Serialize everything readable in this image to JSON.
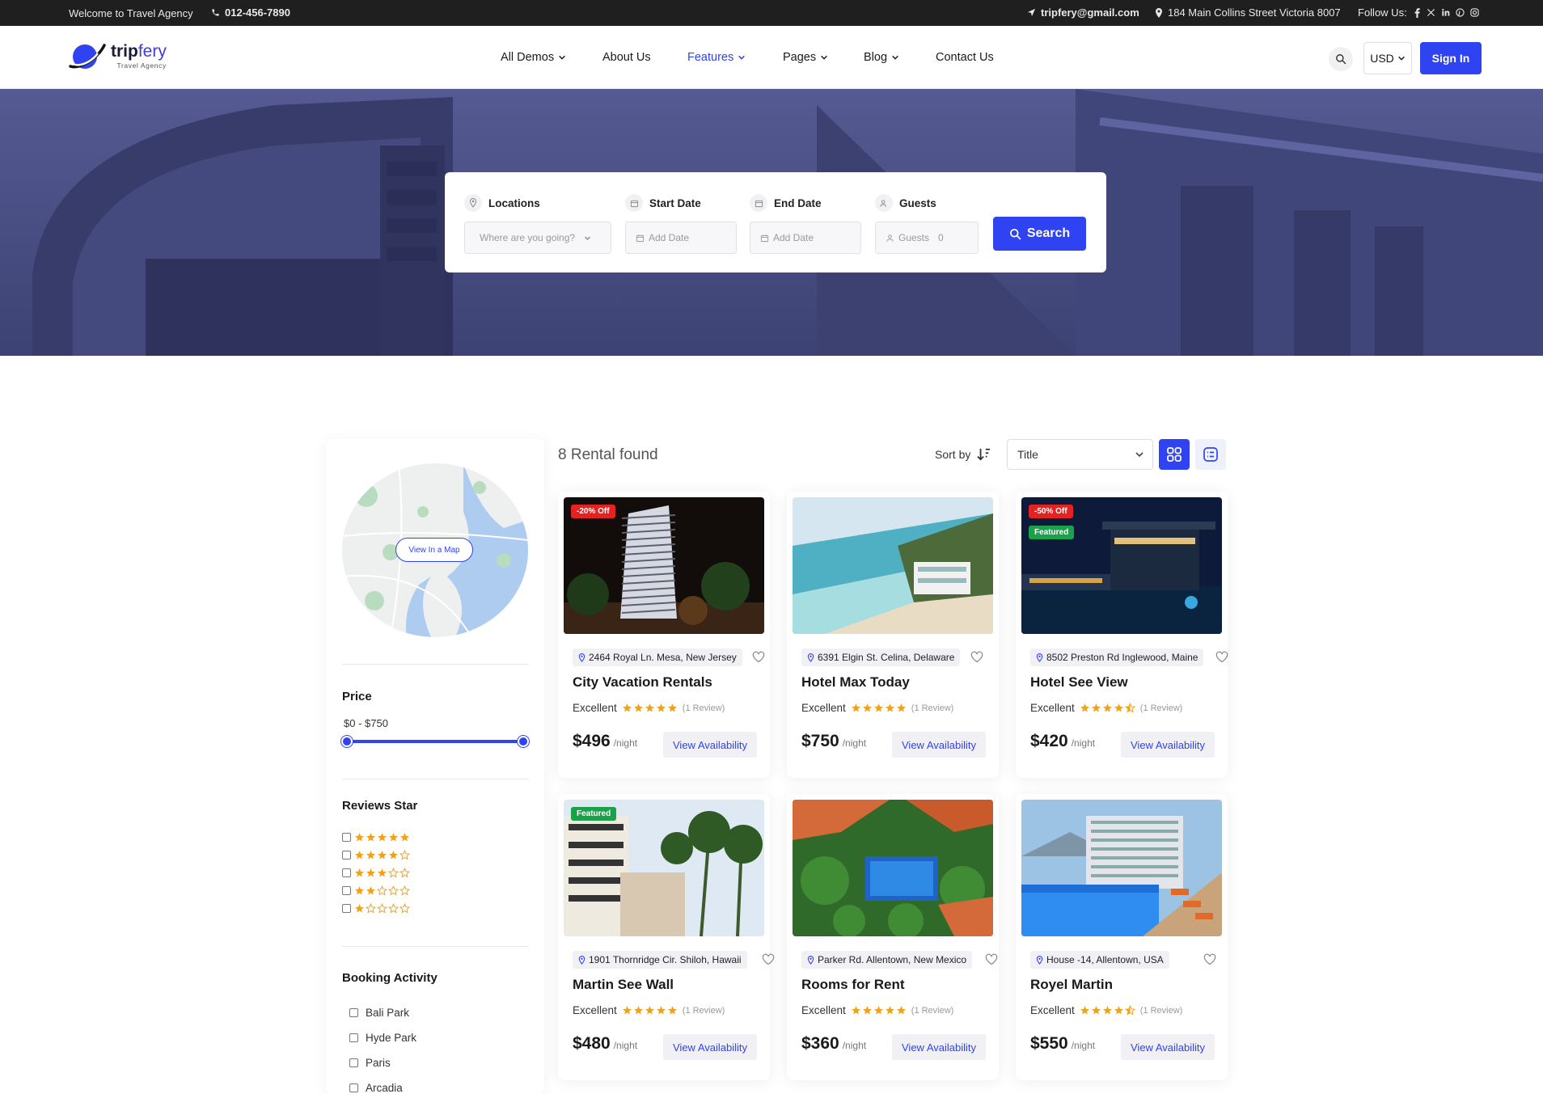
{
  "topbar": {
    "welcome": "Welcome to Travel Agency",
    "phone": "012-456-7890",
    "email": "tripfery@gmail.com",
    "address": "184 Main Collins Street Victoria 8007",
    "follow": "Follow Us:",
    "social_icons": [
      "facebook-icon",
      "x-icon",
      "linkedin-icon",
      "pinterest-icon",
      "instagram-icon"
    ]
  },
  "brand": {
    "name_bold": "trip",
    "name_light": "fery",
    "tagline": "Travel Agency",
    "accent": "#2f43f2"
  },
  "nav": [
    {
      "label": "All Demos",
      "dropdown": true,
      "active": false
    },
    {
      "label": "About Us",
      "dropdown": false,
      "active": false
    },
    {
      "label": "Features",
      "dropdown": true,
      "active": true
    },
    {
      "label": "Pages",
      "dropdown": true,
      "active": false
    },
    {
      "label": "Blog",
      "dropdown": true,
      "active": false
    },
    {
      "label": "Contact Us",
      "dropdown": false,
      "active": false
    }
  ],
  "header": {
    "currency": "USD",
    "signin": "Sign In"
  },
  "search": {
    "locations_label": "Locations",
    "locations_placeholder": "Where are you going?",
    "start_label": "Start Date",
    "start_placeholder": "Add Date",
    "end_label": "End Date",
    "end_placeholder": "Add Date",
    "guests_label": "Guests",
    "guests_placeholder": "Guests",
    "guests_value": "0",
    "button": "Search"
  },
  "sidebar": {
    "map_button": "View In a Map",
    "price_title": "Price",
    "price_range": "$0 - $750",
    "price_min_fraction": 0,
    "price_max_fraction": 1,
    "reviews_title": "Reviews Star",
    "review_levels": [
      5,
      4,
      3,
      2,
      1
    ],
    "booking_title": "Booking Activity",
    "booking_items": [
      "Bali Park",
      "Hyde Park",
      "Paris",
      "Arcadia"
    ]
  },
  "results": {
    "count_text": "8 Rental found",
    "sort_label": "Sort by",
    "sort_value": "Title"
  },
  "cards": [
    {
      "discount": "-20% Off",
      "featured": "",
      "location": "2464 Royal Ln. Mesa, New Jersey",
      "title": "City Vacation Rentals",
      "rating_label": "Excellent",
      "stars": 5,
      "reviews": "(1 Review)",
      "price": "$496",
      "per": "/night",
      "cta": "View Availability"
    },
    {
      "discount": "",
      "featured": "",
      "location": "6391 Elgin St. Celina, Delaware",
      "title": "Hotel Max Today",
      "rating_label": "Excellent",
      "stars": 5,
      "reviews": "(1 Review)",
      "price": "$750",
      "per": "/night",
      "cta": "View Availability"
    },
    {
      "discount": "-50% Off",
      "featured": "Featured",
      "location": "8502 Preston Rd Inglewood, Maine",
      "title": "Hotel See View",
      "rating_label": "Excellent",
      "stars": 4.5,
      "reviews": "(1 Review)",
      "price": "$420",
      "per": "/night",
      "cta": "View Availability"
    },
    {
      "discount": "",
      "featured": "Featured",
      "location": "1901 Thornridge Cir. Shiloh, Hawaii",
      "title": "Martin See Wall",
      "rating_label": "Excellent",
      "stars": 5,
      "reviews": "(1 Review)",
      "price": "$480",
      "per": "/night",
      "cta": "View Availability"
    },
    {
      "discount": "",
      "featured": "",
      "location": "Parker Rd. Allentown, New Mexico",
      "title": "Rooms for Rent",
      "rating_label": "Excellent",
      "stars": 5,
      "reviews": "(1 Review)",
      "price": "$360",
      "per": "/night",
      "cta": "View Availability"
    },
    {
      "discount": "",
      "featured": "",
      "location": "House -14, Allentown, USA",
      "title": "Royel Martin",
      "rating_label": "Excellent",
      "stars": 4.5,
      "reviews": "(1 Review)",
      "price": "$550",
      "per": "/night",
      "cta": "View Availability"
    }
  ]
}
